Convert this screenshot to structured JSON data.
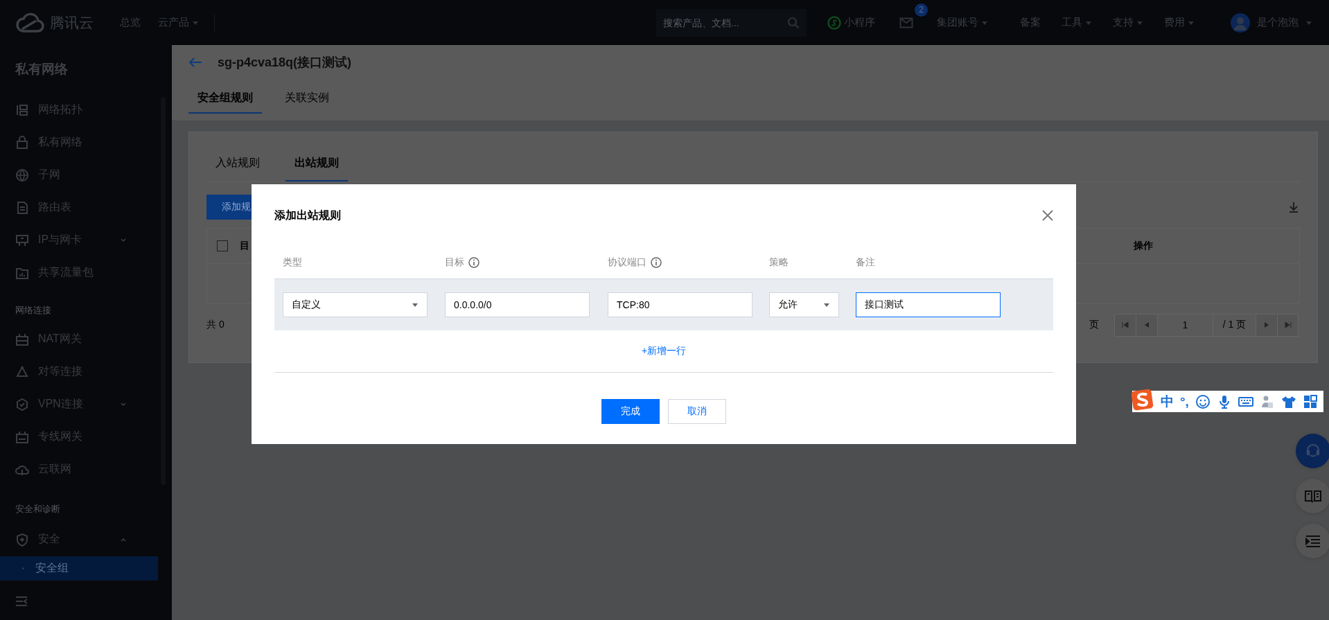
{
  "top_bar": {
    "brand": "腾讯云",
    "nav": [
      {
        "label": "总览",
        "dropdown": false
      },
      {
        "label": "云产品",
        "dropdown": true
      }
    ],
    "search": {
      "placeholder": "搜索产品、文档..."
    },
    "mini_program": "小程序",
    "messages": {
      "badge": "2"
    },
    "menus": [
      {
        "label": "集团账号",
        "dropdown": true
      },
      {
        "label": "备案",
        "dropdown": false
      },
      {
        "label": "工具",
        "dropdown": true
      },
      {
        "label": "支持",
        "dropdown": true
      },
      {
        "label": "费用",
        "dropdown": true
      }
    ],
    "user": {
      "name": "是个泡泡",
      "dropdown": true
    }
  },
  "sidebar": {
    "title": "私有网络",
    "groups": [
      {
        "items": [
          {
            "label": "网络拓扑",
            "selected": false
          },
          {
            "label": "私有网络",
            "selected": false
          },
          {
            "label": "子网",
            "selected": false
          },
          {
            "label": "路由表",
            "selected": false
          },
          {
            "label": "IP与网卡",
            "selected": false,
            "expanded": false
          },
          {
            "label": "共享流量包",
            "selected": false
          }
        ]
      },
      {
        "heading": "网络连接",
        "items": [
          {
            "label": "NAT网关",
            "selected": false
          },
          {
            "label": "对等连接",
            "selected": false
          },
          {
            "label": "VPN连接",
            "selected": false,
            "expanded": false
          },
          {
            "label": "专线网关",
            "selected": false
          },
          {
            "label": "云联网",
            "selected": false
          }
        ]
      },
      {
        "heading": "安全和诊断",
        "items": [
          {
            "label": "安全",
            "selected": false,
            "expanded": true,
            "children": [
              {
                "label": "安全组",
                "selected": true
              }
            ]
          }
        ]
      }
    ]
  },
  "page": {
    "title": "sg-p4cva18q(接口测试)",
    "tabs": [
      {
        "label": "安全组规则",
        "selected": true
      },
      {
        "label": "关联实例",
        "selected": false
      }
    ],
    "card": {
      "tabs": [
        {
          "label": "入站规则",
          "selected": false
        },
        {
          "label": "出站规则",
          "selected": true
        }
      ],
      "add_button": "添加规",
      "table": {
        "select_all": {
          "checked": false
        },
        "columns": [
          "目",
          "操作"
        ]
      },
      "footer": {
        "total": "共 0",
        "page_size_unit": "页",
        "page_input": "1",
        "page_total": "/ 1 页"
      }
    }
  },
  "modal": {
    "title": "添加出站规则",
    "columns": [
      {
        "label": "类型",
        "info": false
      },
      {
        "label": "目标",
        "info": true
      },
      {
        "label": "协议端口",
        "info": true
      },
      {
        "label": "策略",
        "info": false
      },
      {
        "label": "备注",
        "info": false
      }
    ],
    "rows": [
      {
        "cells": [
          {
            "kind": "select",
            "value": "自定义"
          },
          {
            "kind": "input",
            "value": "0.0.0.0/0",
            "focused": false
          },
          {
            "kind": "input",
            "value": "TCP:80",
            "focused": false
          },
          {
            "kind": "select",
            "value": "允许"
          },
          {
            "kind": "input",
            "value": "接口测试",
            "focused": true
          }
        ]
      }
    ],
    "add_row": "+新增一行",
    "buttons": [
      {
        "label": "完成",
        "primary": true
      },
      {
        "label": "取消",
        "primary": false
      }
    ]
  },
  "ime": {
    "mode": "中",
    "punctuation": "°,"
  }
}
